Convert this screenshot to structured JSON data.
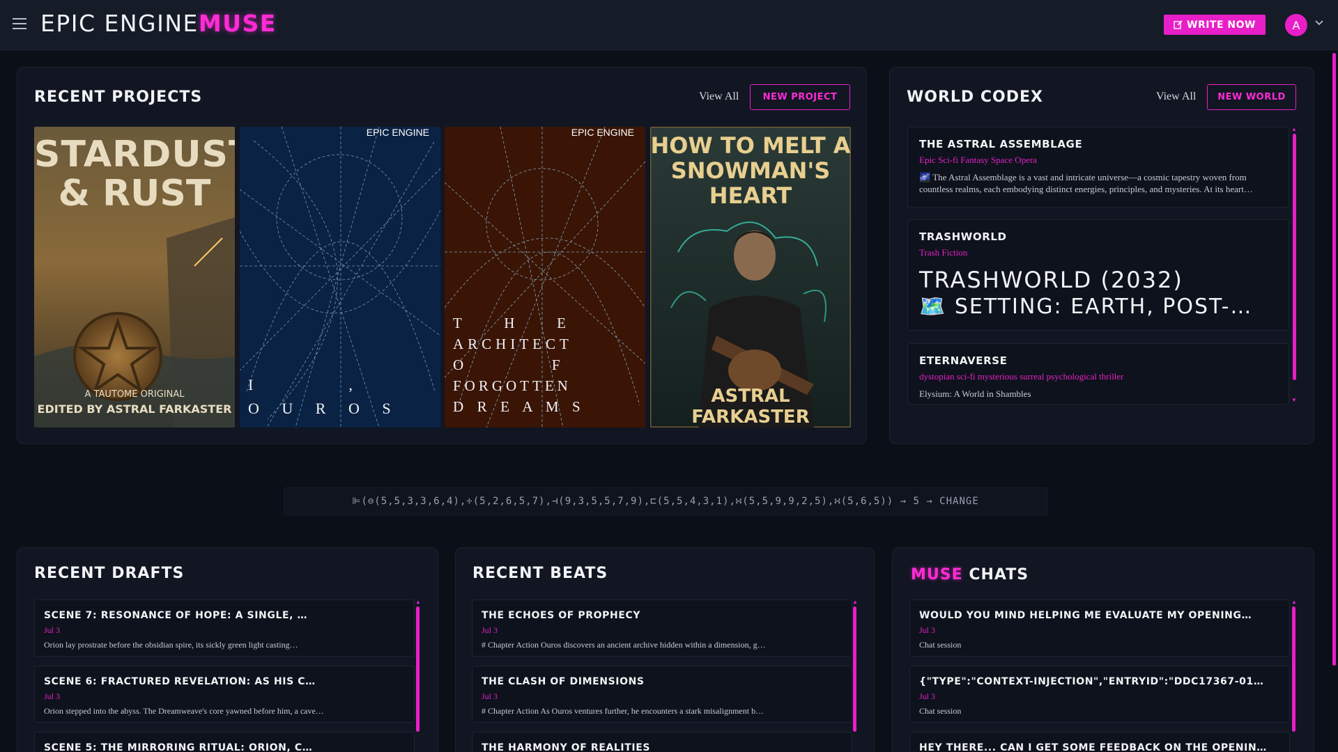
{
  "header": {
    "logo_main": "EPIC ENGINE",
    "logo_accent": "MUSE",
    "write_label": "WRITE NOW",
    "avatar_letter": "A"
  },
  "projects": {
    "title": "RECENT PROJECTS",
    "view_all": "View All",
    "new_label": "NEW PROJECT",
    "covers": [
      {
        "title_l1": "STARDUST",
        "title_l2": "& RUST",
        "tagline": "A TAUTOME ORIGINAL",
        "credit": "EDITED BY ASTRAL FARKASTER"
      },
      {
        "brand": "EPIC ENGINE",
        "l1": "I              ,",
        "l2": "O   U   R   O   S",
        "bg": "#0a2244"
      },
      {
        "brand": "EPIC ENGINE",
        "l1": "T       H       E",
        "l2": "ARCHITECT",
        "l3": "O               F",
        "l4": "FORGOTTEN",
        "l5": "D  R  E  A  M  S",
        "bg": "#3a1405"
      },
      {
        "title_l1": "HOW TO MELT A",
        "title_l2": "SNOWMAN'S",
        "title_l3": "HEART",
        "credit": "ASTRAL FARKASTER"
      }
    ]
  },
  "codex": {
    "title": "WORLD CODEX",
    "view_all": "View All",
    "new_label": "NEW WORLD",
    "items": [
      {
        "title": "THE ASTRAL ASSEMBLAGE",
        "subtitle": "Epic Sci-fi Fantasy Space Opera",
        "text": "🌌 The Astral Assemblage is a vast and intricate universe—a cosmic tapestry woven from countless realms, each embodying distinct energies, principles, and mysteries. At its heart…"
      },
      {
        "title": "TRASHWORLD",
        "subtitle": "Trash Fiction",
        "big_l1": "TRASHWORLD (2032)",
        "big_l2": "🗺️ SETTING: EARTH, POST-…"
      },
      {
        "title": "ETERNAVERSE",
        "subtitle": "dystopian sci-fi mysterious surreal psychological thriller",
        "text": "Elysium: A World in Shambles"
      }
    ]
  },
  "formula": "⊫(⊖(5,5,3,3,6,4),÷(5,2,6,5,7),⊣(9,3,5,5,7,9),⊏(5,5,4,3,1),∺(5,5,9,9,2,5),∺(5,6,5)) → 5 → CHANGE",
  "drafts": {
    "title": "RECENT DRAFTS",
    "items": [
      {
        "title": "SCENE 7: RESONANCE OF HOPE: A SINGLE, …",
        "date": "Jul 3",
        "text": "Orion lay prostrate before the obsidian spire, its sickly green light casting…"
      },
      {
        "title": "SCENE 6: FRACTURED REVELATION: AS HIS C…",
        "date": "Jul 3",
        "text": "Orion stepped into the abyss. The Dreamweave's core yawned before him, a cave…"
      },
      {
        "title": "SCENE 5: THE MIRRORING RITUAL: ORION, C…",
        "date": "",
        "text": ""
      }
    ]
  },
  "beats": {
    "title": "RECENT BEATS",
    "items": [
      {
        "title": "THE ECHOES OF PROPHECY",
        "date": "Jul 3",
        "text": "# Chapter Action Ouros discovers an ancient archive hidden within a dimension, g…"
      },
      {
        "title": "THE CLASH OF DIMENSIONS",
        "date": "Jul 3",
        "text": "# Chapter Action As Ouros ventures further, he encounters a stark misalignment b…"
      },
      {
        "title": "THE HARMONY OF REALITIES",
        "date": "",
        "text": ""
      }
    ]
  },
  "chats": {
    "title_accent": "MUSE",
    "title_rest": "CHATS",
    "items": [
      {
        "title": "WOULD YOU MIND HELPING ME EVALUATE MY OPENING…",
        "date": "Jul 3",
        "text": "Chat session"
      },
      {
        "title": "{\"TYPE\":\"CONTEXT-INJECTION\",\"ENTRYID\":\"DDC17367-01…",
        "date": "Jul 3",
        "text": "Chat session"
      },
      {
        "title": "HEY THERE... CAN I GET SOME FEEDBACK ON THE OPENIN…",
        "date": "",
        "text": ""
      }
    ]
  },
  "colors": {
    "accent": "#e81fc7",
    "bg": "#0b0f17",
    "panel": "#111622"
  }
}
